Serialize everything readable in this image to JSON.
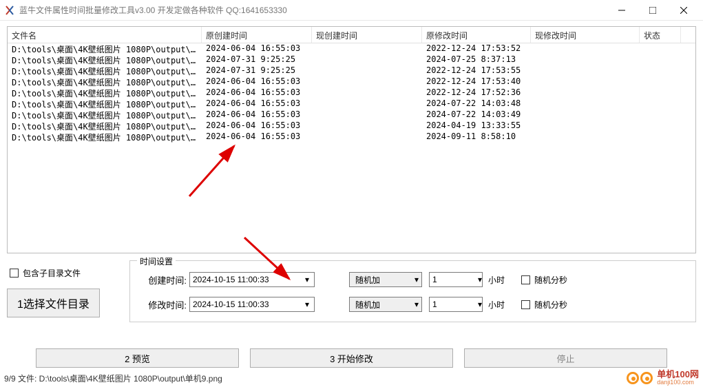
{
  "window": {
    "title": "蓝牛文件属性时间批量修改工具v3.00  开发定做各种软件  QQ:1641653330"
  },
  "table": {
    "headers": {
      "filename": "文件名",
      "orig_create": "原创建时间",
      "new_create": "现创建时间",
      "orig_modify": "原修改时间",
      "new_modify": "现修改时间",
      "status": "状态"
    },
    "rows": [
      {
        "filename": "D:\\tools\\桌面\\4K壁纸图片 1080P\\output\\单机...",
        "oc": "2024-06-04 16:55:03",
        "nc": "",
        "om": "2022-12-24 17:53:52",
        "nm": "",
        "st": ""
      },
      {
        "filename": "D:\\tools\\桌面\\4K壁纸图片 1080P\\output\\单机...",
        "oc": "2024-07-31 9:25:25",
        "nc": "",
        "om": "2024-07-25 8:37:13",
        "nm": "",
        "st": ""
      },
      {
        "filename": "D:\\tools\\桌面\\4K壁纸图片 1080P\\output\\单机...",
        "oc": "2024-07-31 9:25:25",
        "nc": "",
        "om": "2022-12-24 17:53:55",
        "nm": "",
        "st": ""
      },
      {
        "filename": "D:\\tools\\桌面\\4K壁纸图片 1080P\\output\\单机...",
        "oc": "2024-06-04 16:55:03",
        "nc": "",
        "om": "2022-12-24 17:53:40",
        "nm": "",
        "st": ""
      },
      {
        "filename": "D:\\tools\\桌面\\4K壁纸图片 1080P\\output\\单机...",
        "oc": "2024-06-04 16:55:03",
        "nc": "",
        "om": "2022-12-24 17:52:36",
        "nm": "",
        "st": ""
      },
      {
        "filename": "D:\\tools\\桌面\\4K壁纸图片 1080P\\output\\单机...",
        "oc": "2024-06-04 16:55:03",
        "nc": "",
        "om": "2024-07-22 14:03:48",
        "nm": "",
        "st": ""
      },
      {
        "filename": "D:\\tools\\桌面\\4K壁纸图片 1080P\\output\\单机...",
        "oc": "2024-06-04 16:55:03",
        "nc": "",
        "om": "2024-07-22 14:03:49",
        "nm": "",
        "st": ""
      },
      {
        "filename": "D:\\tools\\桌面\\4K壁纸图片 1080P\\output\\单机...",
        "oc": "2024-06-04 16:55:03",
        "nc": "",
        "om": "2024-04-19 13:33:55",
        "nm": "",
        "st": ""
      },
      {
        "filename": "D:\\tools\\桌面\\4K壁纸图片 1080P\\output\\单机...",
        "oc": "2024-06-04 16:55:03",
        "nc": "",
        "om": "2024-09-11 8:58:10",
        "nm": "",
        "st": ""
      }
    ]
  },
  "controls": {
    "include_subdir": "包含子目录文件",
    "select_dir_btn": "1选择文件目录"
  },
  "fieldset": {
    "legend": "时间设置",
    "row1": {
      "label": "创建时间:",
      "value": "2024-10-15 11:00:33",
      "combo": "随机加",
      "num": "1",
      "unit": "小时",
      "rand_chk": "随机分秒"
    },
    "row2": {
      "label": "修改时间:",
      "value": "2024-10-15 11:00:33",
      "combo": "随机加",
      "num": "1",
      "unit": "小时",
      "rand_chk": "随机分秒"
    }
  },
  "buttons": {
    "preview": "2 预览",
    "start": "3 开始修改",
    "stop": "停止"
  },
  "statusbar": "9/9 文件:  D:\\tools\\桌面\\4K壁纸图片 1080P\\output\\单机9.png",
  "logo": {
    "name": "单机100网",
    "url": "danji100.com"
  }
}
